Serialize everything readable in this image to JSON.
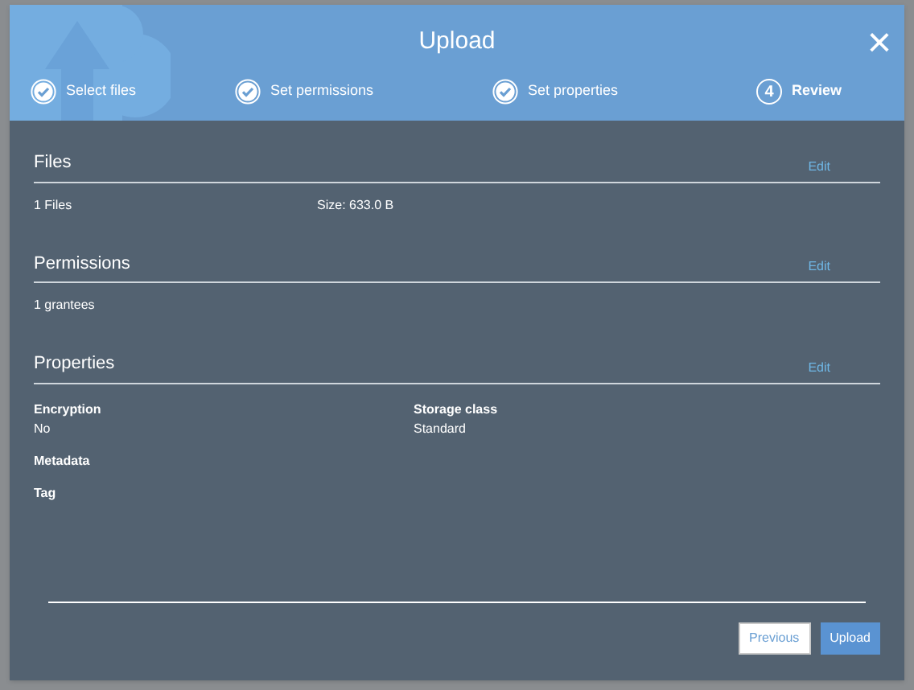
{
  "dialog": {
    "title": "Upload",
    "close": "×"
  },
  "steps": [
    {
      "label": "Select files",
      "done": true,
      "selected": false
    },
    {
      "label": "Set permissions",
      "done": true,
      "selected": false
    },
    {
      "label": "Set properties",
      "done": true,
      "selected": false
    },
    {
      "label": "Review",
      "done": false,
      "selected": true,
      "number": "4"
    }
  ],
  "sections": [
    {
      "title": "Files",
      "edit": "Edit",
      "kind": "row",
      "items": [
        {
          "text": "1 Files"
        },
        {
          "text": "Size: 633.0 B"
        }
      ]
    },
    {
      "title": "Permissions",
      "edit": "Edit",
      "kind": "row",
      "items": [
        {
          "text": "1 grantees"
        }
      ]
    },
    {
      "title": "Properties",
      "edit": "Edit",
      "kind": "fields",
      "items": [
        {
          "label": "Encryption",
          "value": "No"
        },
        {
          "label": "Storage class",
          "value": "Standard"
        },
        {
          "label": "Metadata"
        },
        {
          "label": "Tag"
        }
      ]
    }
  ],
  "buttons": [
    {
      "label": "Previous",
      "kind": "secondary"
    },
    {
      "label": "Upload",
      "kind": "primary"
    }
  ]
}
